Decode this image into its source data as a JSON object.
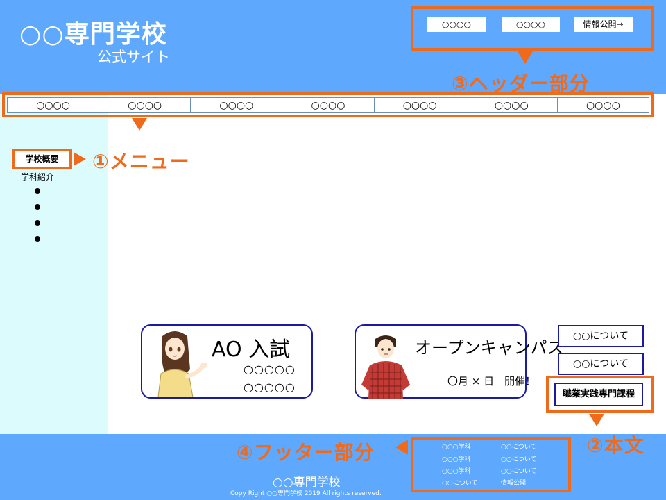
{
  "header": {
    "site_title": "○○専門学校",
    "site_subtitle": "公式サイト",
    "buttons": [
      "○○○○",
      "○○○○",
      "情報公開→"
    ]
  },
  "nav": {
    "items": [
      "○○○○",
      "○○○○",
      "○○○○",
      "○○○○",
      "○○○○",
      "○○○○",
      "○○○○"
    ]
  },
  "sidebar": {
    "active_item": "学校概要",
    "item2": "学科紹介"
  },
  "banners": {
    "ao": {
      "title": "AO 入試",
      "line1": "○○○○○",
      "line2": "○○○○○"
    },
    "open_campus": {
      "title": "オープンキャンパス",
      "date": "〇月 × 日　開催！"
    }
  },
  "side_links": [
    "○○について",
    "○○について",
    "職業実践専門課程"
  ],
  "footer": {
    "links": [
      [
        "○○○学科",
        "○○について"
      ],
      [
        "○○○学科",
        "○○について"
      ],
      [
        "○○○学科",
        "○○について"
      ],
      [
        "○○について",
        "情報公開"
      ]
    ],
    "title": "○○専門学校",
    "copyright": "Copy Right ○○専門学校 2019  All rights reserved."
  },
  "callouts": {
    "menu": "①メニュー",
    "body": "②本文",
    "header": "③ヘッダー部分",
    "footer": "④フッター部分"
  },
  "colors": {
    "header_bg": "#5ea9fd",
    "sidebar_bg": "#dcfbfd",
    "callout": "#f06a1c",
    "banner_border": "#1a1aa3"
  }
}
